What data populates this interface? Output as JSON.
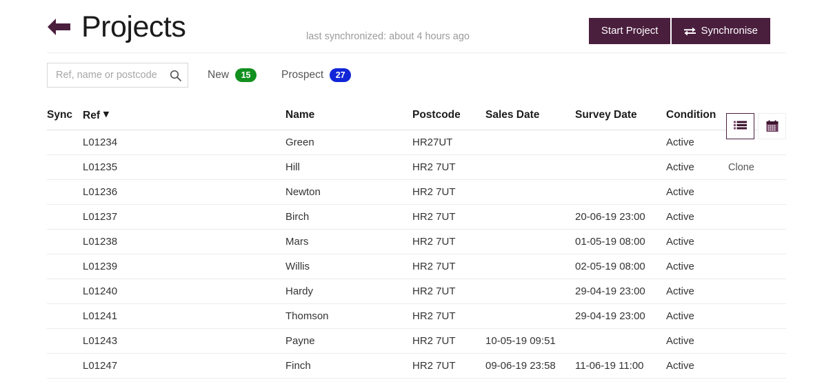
{
  "header": {
    "back_icon": "back-arrow-icon",
    "title": "Projects",
    "sync_note": "last synchronized: about 4 hours ago",
    "start_project_label": "Start Project",
    "synchronise_label": "Synchronise",
    "synchronise_icon": "exchange-arrows-icon",
    "accent_color": "#4a1e3d"
  },
  "toolbar": {
    "search_placeholder": "Ref, name or postcode",
    "search_value": "",
    "search_icon": "search-icon",
    "filters": [
      {
        "label": "New",
        "count": "15",
        "color": "#12901f"
      },
      {
        "label": "Prospect",
        "count": "27",
        "color": "#1226d8"
      }
    ],
    "views": [
      {
        "name": "list-view",
        "icon": "list-icon",
        "active": true
      },
      {
        "name": "calendar-view",
        "icon": "calendar-icon",
        "active": false
      }
    ]
  },
  "table": {
    "columns": [
      "Sync",
      "Ref",
      "Name",
      "Postcode",
      "Sales Date",
      "Survey Date",
      "Condition"
    ],
    "sort_column": "Ref",
    "sort_caret": "▾",
    "rows": [
      {
        "sync": "",
        "ref": "L01234",
        "name": "Green",
        "postcode": "HR27UT",
        "sales_date": "",
        "survey_date": "",
        "condition": "Active",
        "action": ""
      },
      {
        "sync": "",
        "ref": "L01235",
        "name": "Hill",
        "postcode": "HR2 7UT",
        "sales_date": "",
        "survey_date": "",
        "condition": "Active",
        "action": "Clone"
      },
      {
        "sync": "",
        "ref": "L01236",
        "name": "Newton",
        "postcode": "HR2 7UT",
        "sales_date": "",
        "survey_date": "",
        "condition": "Active",
        "action": ""
      },
      {
        "sync": "",
        "ref": "L01237",
        "name": "Birch",
        "postcode": "HR2 7UT",
        "sales_date": "",
        "survey_date": "20-06-19 23:00",
        "condition": "Active",
        "action": ""
      },
      {
        "sync": "",
        "ref": "L01238",
        "name": "Mars",
        "postcode": "HR2 7UT",
        "sales_date": "",
        "survey_date": "01-05-19 08:00",
        "condition": "Active",
        "action": ""
      },
      {
        "sync": "",
        "ref": "L01239",
        "name": "Willis",
        "postcode": "HR2 7UT",
        "sales_date": "",
        "survey_date": "02-05-19 08:00",
        "condition": "Active",
        "action": ""
      },
      {
        "sync": "",
        "ref": "L01240",
        "name": "Hardy",
        "postcode": "HR2 7UT",
        "sales_date": "",
        "survey_date": "29-04-19 23:00",
        "condition": "Active",
        "action": ""
      },
      {
        "sync": "",
        "ref": "L01241",
        "name": "Thomson",
        "postcode": "HR2 7UT",
        "sales_date": "",
        "survey_date": "29-04-19 23:00",
        "condition": "Active",
        "action": ""
      },
      {
        "sync": "",
        "ref": "L01243",
        "name": "Payne",
        "postcode": "HR2 7UT",
        "sales_date": "10-05-19 09:51",
        "survey_date": "",
        "condition": "Active",
        "action": ""
      },
      {
        "sync": "",
        "ref": "L01247",
        "name": "Finch",
        "postcode": "HR2 7UT",
        "sales_date": "09-06-19 23:58",
        "survey_date": "11-06-19 11:00",
        "condition": "Active",
        "action": ""
      }
    ]
  }
}
